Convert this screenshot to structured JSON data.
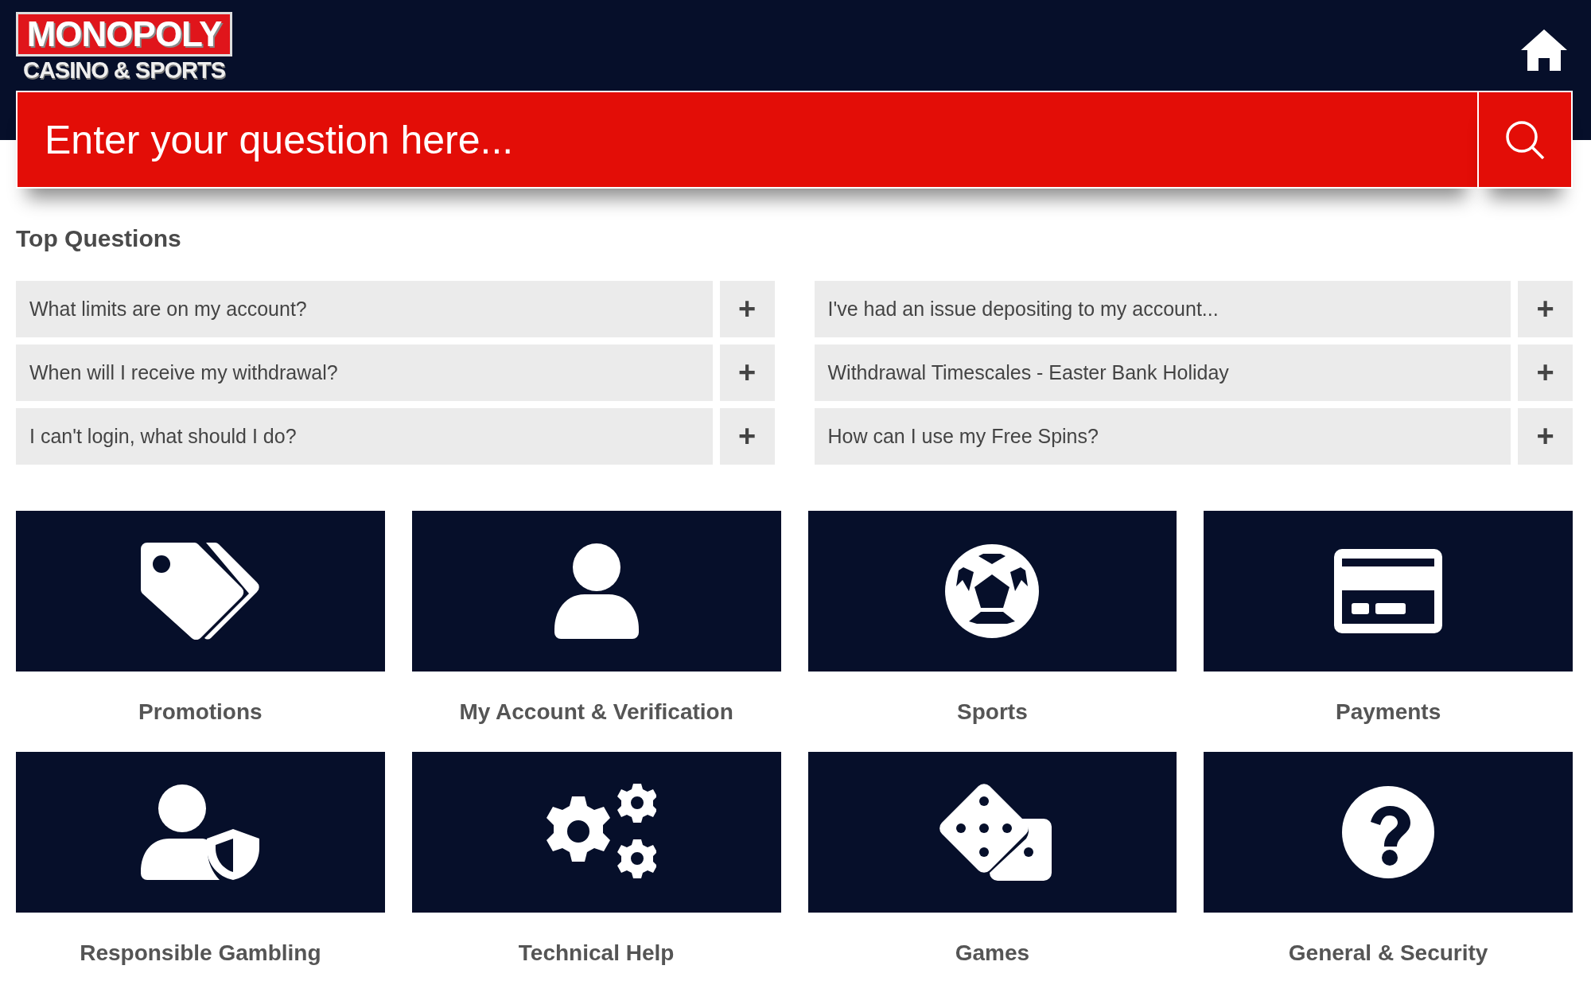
{
  "header": {
    "logo": {
      "title": "MONOPOLY",
      "subtitle": "CASINO & SPORTS"
    }
  },
  "search": {
    "placeholder": "Enter your question here..."
  },
  "top_questions": {
    "title": "Top Questions",
    "columns": [
      [
        {
          "question": "What limits are on my account?",
          "expand": "+"
        },
        {
          "question": "When will I receive my withdrawal?",
          "expand": "+"
        },
        {
          "question": "I can't login, what should I do?",
          "expand": "+"
        }
      ],
      [
        {
          "question": "I've had an issue depositing to my account...",
          "expand": "+"
        },
        {
          "question": "Withdrawal Timescales - Easter Bank Holiday",
          "expand": "+"
        },
        {
          "question": "How can I use my Free Spins?",
          "expand": "+"
        }
      ]
    ]
  },
  "categories": [
    {
      "label": "Promotions"
    },
    {
      "label": "My Account & Verification"
    },
    {
      "label": "Sports"
    },
    {
      "label": "Payments"
    },
    {
      "label": "Responsible Gambling"
    },
    {
      "label": "Technical Help"
    },
    {
      "label": "Games"
    },
    {
      "label": "General & Security"
    }
  ]
}
